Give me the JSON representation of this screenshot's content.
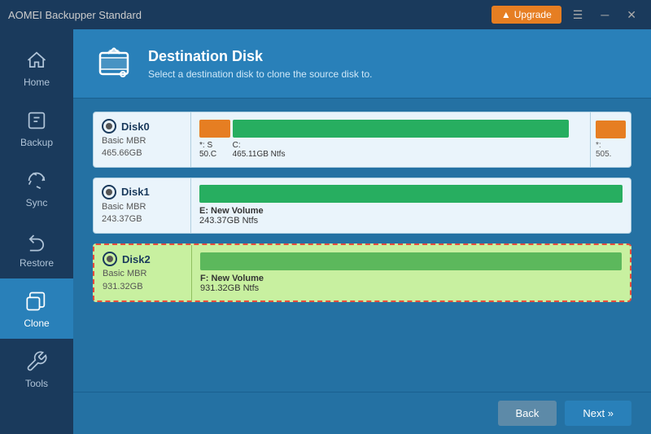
{
  "titleBar": {
    "appName": "AOMEI Backupper Standard",
    "upgradeLabel": "Upgrade"
  },
  "sidebar": {
    "items": [
      {
        "id": "home",
        "label": "Home",
        "active": false
      },
      {
        "id": "backup",
        "label": "Backup",
        "active": false
      },
      {
        "id": "sync",
        "label": "Sync",
        "active": false
      },
      {
        "id": "restore",
        "label": "Restore",
        "active": false
      },
      {
        "id": "clone",
        "label": "Clone",
        "active": true
      },
      {
        "id": "tools",
        "label": "Tools",
        "active": false
      }
    ]
  },
  "header": {
    "title": "Destination Disk",
    "subtitle": "Select a destination disk to clone the source disk to."
  },
  "disks": [
    {
      "id": "disk0",
      "name": "Disk0",
      "type": "Basic MBR",
      "size": "465.66GB",
      "selected": false,
      "partitions": [
        {
          "label": "*: S",
          "size": "50.C",
          "widthPct": 8,
          "type": "small"
        },
        {
          "label": "C:",
          "size": "465.11GB Ntfs",
          "widthPct": 85,
          "type": "data"
        }
      ],
      "extra": {
        "label": "*:",
        "size": "505."
      }
    },
    {
      "id": "disk1",
      "name": "Disk1",
      "type": "Basic MBR",
      "size": "243.37GB",
      "selected": false,
      "partitions": [
        {
          "label": "E: New Volume",
          "size": "243.37GB Ntfs",
          "widthPct": 100,
          "type": "data"
        }
      ]
    },
    {
      "id": "disk2",
      "name": "Disk2",
      "type": "Basic MBR",
      "size": "931.32GB",
      "selected": true,
      "partitions": [
        {
          "label": "F: New Volume",
          "size": "931.32GB Ntfs",
          "widthPct": 100,
          "type": "data"
        }
      ]
    }
  ],
  "footer": {
    "backLabel": "Back",
    "nextLabel": "Next »"
  },
  "colors": {
    "accent": "#2980b9",
    "upgrade": "#e67e22",
    "selectedBorder": "#e74c3c",
    "selectedBg": "#c8f0a0"
  }
}
